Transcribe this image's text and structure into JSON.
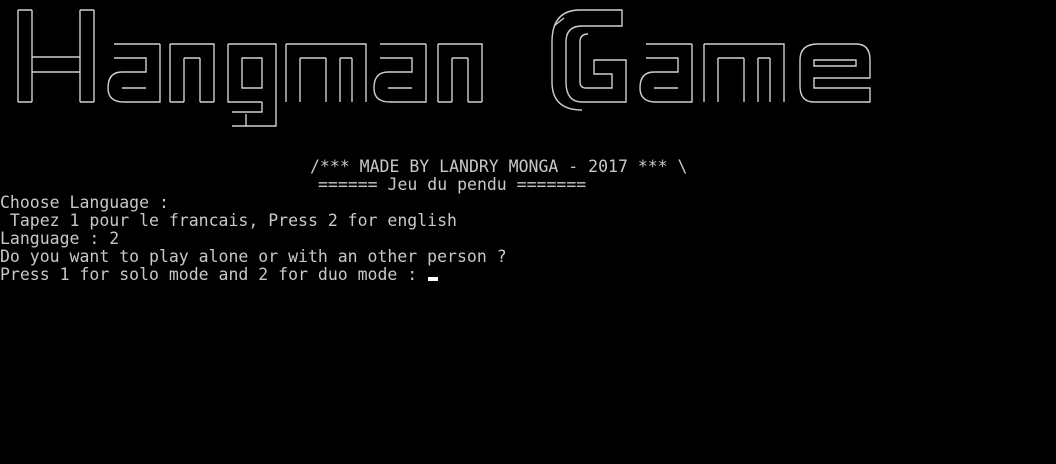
{
  "banner": {
    "ascii_title": "Hangman Game"
  },
  "console": {
    "credits_line": "/*** MADE BY LANDRY MONGA - 2017 *** \\",
    "subtitle_line": "====== Jeu du pendu =======",
    "lines": [
      "Choose Language :",
      " Tapez 1 pour le francais, Press 2 for english",
      "Language : 2",
      "Do you want to play alone or with an other person ?",
      "Press 1 for solo mode and 2 for duo mode : "
    ]
  },
  "colors": {
    "background": "#000000",
    "text": "#c0c0c0"
  }
}
